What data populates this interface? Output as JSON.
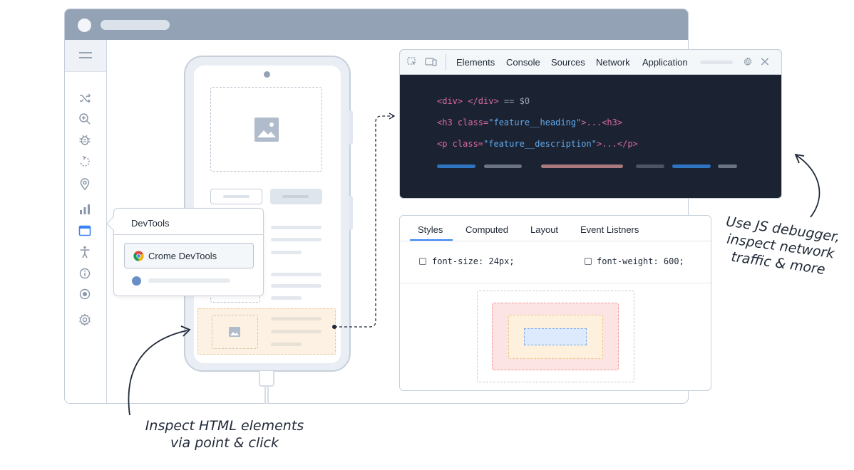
{
  "popup": {
    "title": "DevTools",
    "chrome_label": "Crome DevTools",
    "icons": [
      "chrome-icon",
      "safari-icon"
    ]
  },
  "devtools": {
    "tabs": [
      "Elements",
      "Console",
      "Sources",
      "Network",
      "Application"
    ],
    "code": {
      "line1": {
        "tag": "<div> </div>",
        "rest": " == $0"
      },
      "line2": {
        "open": "<h3 class=",
        "value": "\"feature__heading\"",
        "close": ">...<h3>"
      },
      "line3": {
        "open": "<p class=",
        "value": "\"feature__description\"",
        "close": ">...</p>"
      }
    }
  },
  "styles": {
    "tabs": [
      "Styles",
      "Computed",
      "Layout",
      "Event Listners"
    ],
    "props": [
      "font-size: 24px;",
      "font-weight: 600;"
    ]
  },
  "annotations": {
    "left": [
      "Inspect HTML elements",
      "via point & click"
    ],
    "right": [
      "Use JS debugger,",
      "inspect network",
      "traffic & more"
    ]
  },
  "sidebar_icons": [
    "shuffle-icon",
    "zoom-icon",
    "bug-icon",
    "rotate-icon",
    "location-icon",
    "chart-icon",
    "window-icon",
    "accessibility-icon",
    "info-icon",
    "record-icon",
    "gear-icon"
  ],
  "colors": {
    "titlebar": "#93a2b5",
    "console_bg": "#1b2332",
    "accent": "#3b82f6",
    "highlight": "#fdf1e3"
  }
}
